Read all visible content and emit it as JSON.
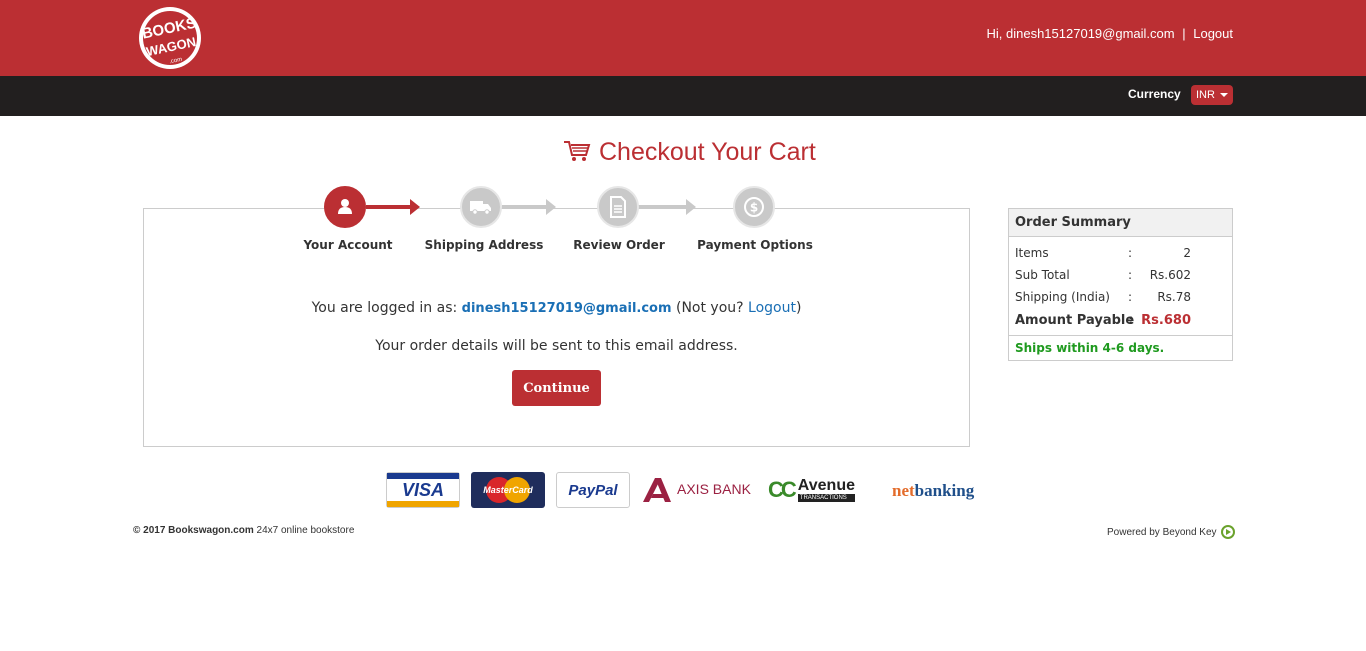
{
  "header": {
    "logo_text_top": "BOOKS",
    "logo_text_bottom": "WAGON",
    "logo_text_suffix": ".com",
    "greeting": "Hi, dinesh15127019@gmail.com",
    "separator": "|",
    "logout": "Logout",
    "brand_color": "#bb2f33"
  },
  "currency": {
    "label": "Currency",
    "selected": "INR"
  },
  "page": {
    "title": "Checkout Your Cart",
    "cart_icon": "cart-icon"
  },
  "steps": [
    {
      "label": "Your Account",
      "icon": "user-icon",
      "active": true
    },
    {
      "label": "Shipping Address",
      "icon": "truck-icon",
      "active": false
    },
    {
      "label": "Review Order",
      "icon": "document-icon",
      "active": false
    },
    {
      "label": "Payment Options",
      "icon": "dollar-icon",
      "active": false
    }
  ],
  "account": {
    "logged_in_prefix": "You are logged in as:",
    "email": "dinesh15127019@gmail.com",
    "not_you_prefix": "(Not you?",
    "logout_link": "Logout",
    "not_you_suffix": ")",
    "note": "Your order details will be sent to this email address.",
    "continue": "Continue"
  },
  "summary": {
    "title": "Order Summary",
    "rows": [
      {
        "label": "Items",
        "colon": ":",
        "value": "2"
      },
      {
        "label": "Sub Total",
        "colon": ":",
        "value": "Rs.602"
      },
      {
        "label": "Shipping (India)",
        "colon": ":",
        "value": "Rs.78"
      },
      {
        "label": "Amount Payable",
        "colon": ":",
        "value": "Rs.680"
      }
    ],
    "ships": "Ships within 4-6 days."
  },
  "payments": {
    "visa": "VISA",
    "mastercard": "MasterCard",
    "paypal": "PayPal",
    "axis": "AXIS BANK",
    "ccavenue": "Avenue",
    "ccavenue_prefix": "CC",
    "ccavenue_sub": "TRANSACTIONS",
    "netbanking_a": "net",
    "netbanking_b": "banking"
  },
  "footer": {
    "copyright": "© 2017 Bookswagon.com",
    "tagline": "24x7 online bookstore",
    "powered": "Powered by Beyond Key"
  }
}
